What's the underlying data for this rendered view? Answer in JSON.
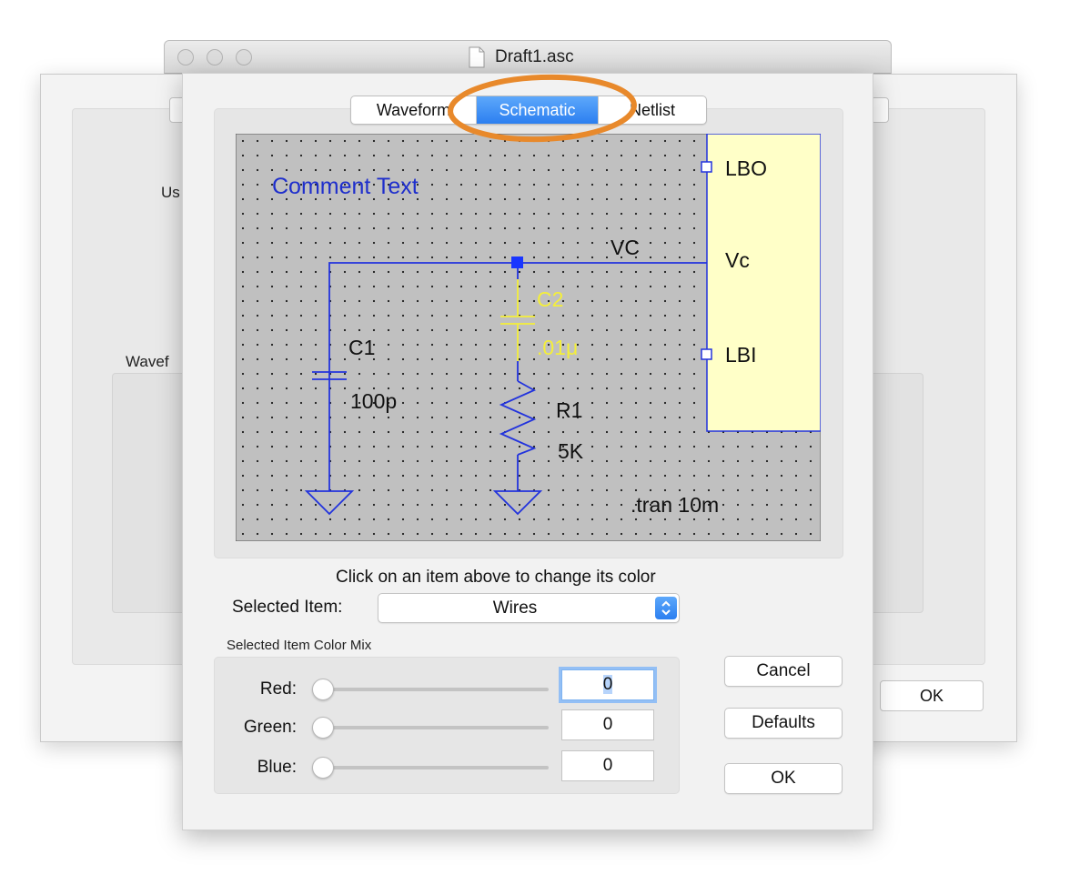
{
  "background_window": {
    "label_user": "Us",
    "label_waveform": "Wavef",
    "ok_label": "OK"
  },
  "window": {
    "title": "Draft1.asc"
  },
  "tabs": [
    {
      "label": "Waveform",
      "selected": false
    },
    {
      "label": "Schematic",
      "selected": true
    },
    {
      "label": "Netlist",
      "selected": false
    }
  ],
  "schematic_preview": {
    "comment": "Comment Text",
    "net_label": "VC",
    "pins": [
      "LBO",
      "Vc",
      "LBI"
    ],
    "c1": {
      "name": "C1",
      "value": "100p"
    },
    "c2": {
      "name": "C2",
      "value": ".01μ"
    },
    "r1": {
      "name": "R1",
      "value": "5K"
    },
    "directive": ".tran 10m",
    "colors": {
      "background": "#c0c0c0",
      "wire": "#2233dd",
      "comment": "#1f2fcc",
      "selected_component": "#f4ef3a",
      "ic_body": "#ffffc8",
      "text": "#111111"
    }
  },
  "hint": "Click on an item above to change its color",
  "selected_item": {
    "label": "Selected Item:",
    "value": "Wires"
  },
  "color_mix": {
    "label": "Selected Item Color Mix",
    "red": {
      "label": "Red:",
      "value": "0",
      "level": 0
    },
    "green": {
      "label": "Green:",
      "value": "0",
      "level": 0
    },
    "blue": {
      "label": "Blue:",
      "value": "0",
      "level": 0
    }
  },
  "buttons": {
    "cancel": "Cancel",
    "defaults": "Defaults",
    "ok": "OK"
  },
  "accent_color": "#2c7ff0",
  "annotation_color": "#e8892b"
}
